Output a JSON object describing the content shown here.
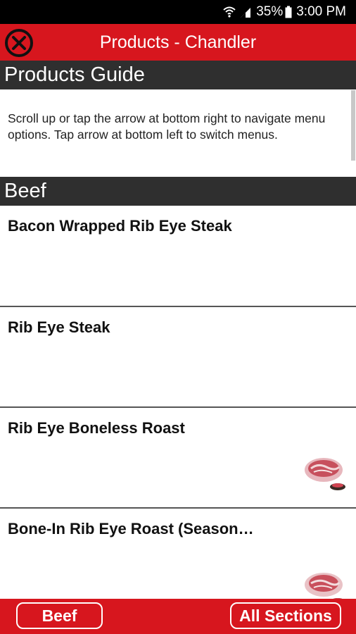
{
  "status_bar": {
    "battery": "35%",
    "time": "3:00 PM"
  },
  "app_bar": {
    "title": "Products - Chandler",
    "close_icon": "close-circle-icon"
  },
  "guide": {
    "header": "Products Guide",
    "text": "Scroll up or tap the arrow at bottom right to navigate menu options. Tap arrow at bottom left to switch menus."
  },
  "section": {
    "header": "Beef"
  },
  "products": [
    {
      "name": "Bacon Wrapped Rib Eye Steak",
      "image": ""
    },
    {
      "name": "Rib Eye Steak",
      "image": ""
    },
    {
      "name": "Rib Eye Boneless Roast",
      "image": "beef-roast-icon"
    },
    {
      "name": "Bone-In Rib Eye Roast (Season…",
      "image": "beef-roast-icon"
    }
  ],
  "bottom_bar": {
    "left_label": "Beef",
    "right_label": "All Sections"
  },
  "colors": {
    "brand_red": "#d7161e",
    "header_dark": "#2f2f2f"
  }
}
